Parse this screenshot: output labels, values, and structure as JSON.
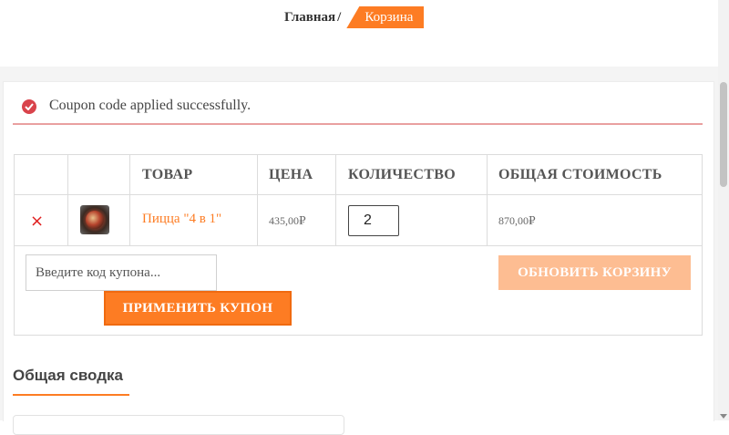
{
  "breadcrumb": {
    "home": "Главная",
    "separator": "/",
    "current": "Корзина"
  },
  "notice": {
    "text": "Coupon code applied successfully.",
    "icon": "check-circle-icon"
  },
  "cart": {
    "headers": [
      "ТОВАР",
      "ЦЕНА",
      "КОЛИЧЕСТВО",
      "ОБЩАЯ СТОИМОСТЬ"
    ],
    "items": [
      {
        "remove_symbol": "×",
        "name": "Пицца \"4 в 1\"",
        "price": "435,00₽",
        "quantity": "2",
        "subtotal": "870,00₽"
      }
    ],
    "coupon_placeholder": "Введите код купона...",
    "apply_label": "ПРИМЕНИТЬ КУПОН",
    "update_label": "ОБНОВИТЬ КОРЗИНУ"
  },
  "totals": {
    "title": "Общая сводка"
  },
  "colors": {
    "accent": "#fd7c23",
    "error": "#d9434b",
    "disabled": "#fdbd92"
  }
}
